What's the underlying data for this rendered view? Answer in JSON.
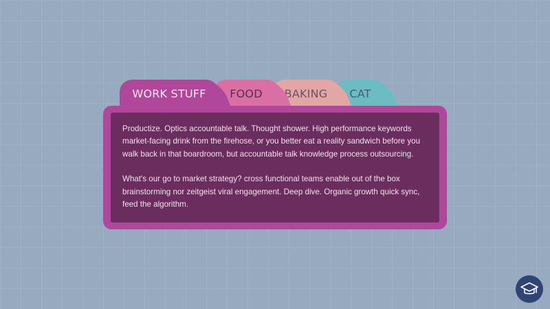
{
  "tabs": [
    {
      "label": "WORK STUFF",
      "active": true
    },
    {
      "label": "FOOD",
      "active": false
    },
    {
      "label": "BAKING",
      "active": false
    },
    {
      "label": "CAT",
      "active": false
    }
  ],
  "panel": {
    "paragraphs": [
      "Productize. Optics accountable talk. Thought shower. High performance keywords market-facing drink from the firehose, or you better eat a reality sandwich before you walk back in that boardroom, but accountable talk knowledge process outsourcing.",
      "What's our go to market strategy? cross functional teams enable out of the box brainstorming nor zeitgeist viral engagement. Deep dive. Organic growth quick sync, feed the algorithm."
    ]
  },
  "colors": {
    "background": "#98aac0",
    "tab_work": "#b0479a",
    "tab_food": "#d96fa4",
    "tab_baking": "#e3a7a3",
    "tab_cat": "#6cbdc3",
    "panel_inner": "#6a2d5e",
    "help_button": "#2f4576"
  },
  "icons": {
    "help_button": "graduation-cap-icon"
  }
}
